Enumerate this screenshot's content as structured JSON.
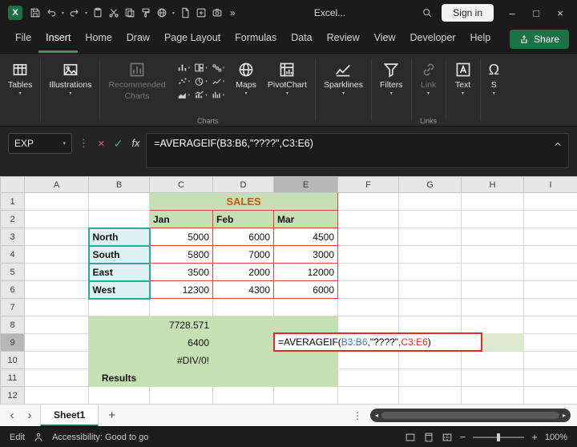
{
  "titlebar": {
    "app_title": "Excel...",
    "sign_in_label": "Sign in"
  },
  "menubar": {
    "items": [
      {
        "label": "File"
      },
      {
        "label": "Insert"
      },
      {
        "label": "Home"
      },
      {
        "label": "Draw"
      },
      {
        "label": "Page Layout"
      },
      {
        "label": "Formulas"
      },
      {
        "label": "Data"
      },
      {
        "label": "Review"
      },
      {
        "label": "View"
      },
      {
        "label": "Developer"
      },
      {
        "label": "Help"
      }
    ],
    "share_label": "Share"
  },
  "ribbon": {
    "tables_label": "Tables",
    "illustrations_label": "Illustrations",
    "recommended_line1": "Recommended",
    "recommended_line2": "Charts",
    "maps_label": "Maps",
    "pivotchart_label": "PivotChart",
    "sparklines_label": "Sparklines",
    "filters_label": "Filters",
    "link_label": "Link",
    "text_label": "Text",
    "symbols_label": "S",
    "charts_group_label": "Charts",
    "links_group_label": "Links"
  },
  "formula_bar": {
    "name_box_value": "EXP",
    "fx_label": "fx",
    "formula": "=AVERAGEIF(B3:B6,\"????\",C3:E6)"
  },
  "grid": {
    "col_headers": [
      "A",
      "B",
      "C",
      "D",
      "E",
      "F",
      "G",
      "H",
      "I"
    ],
    "row_headers": [
      "1",
      "2",
      "3",
      "4",
      "5",
      "6",
      "7",
      "8",
      "9",
      "10",
      "11",
      "12"
    ],
    "sales_title": "SALES",
    "months": [
      "Jan",
      "Feb",
      "Mar"
    ],
    "regions": [
      "North",
      "South",
      "East",
      "West"
    ],
    "values": [
      [
        "5000",
        "6000",
        "4500"
      ],
      [
        "5800",
        "7000",
        "3000"
      ],
      [
        "3500",
        "2000",
        "12000"
      ],
      [
        "12300",
        "4300",
        "6000"
      ]
    ],
    "result_avg": "7728.571",
    "result_mid": "6400",
    "result_err": "#DIV/0!",
    "results_label": "Results",
    "active_formula": {
      "prefix": "=AVERAGEIF(",
      "ref1": "B3:B6",
      "mid": ",\"????\",",
      "ref2": "C3:E6",
      "suffix": ")"
    }
  },
  "sheetbar": {
    "tab": "Sheet1"
  },
  "statusbar": {
    "mode": "Edit",
    "accessibility": "Accessibility: Good to go",
    "zoom": "100%"
  },
  "colors": {
    "accent_green": "#21a366",
    "table_border_red": "#e83e3e",
    "region_border_teal": "#2ba7a0",
    "fill_green": "#c6e0b4",
    "sales_text_orange": "#c45911",
    "ref_blue": "#4472c4",
    "ref_red": "#d93025"
  }
}
